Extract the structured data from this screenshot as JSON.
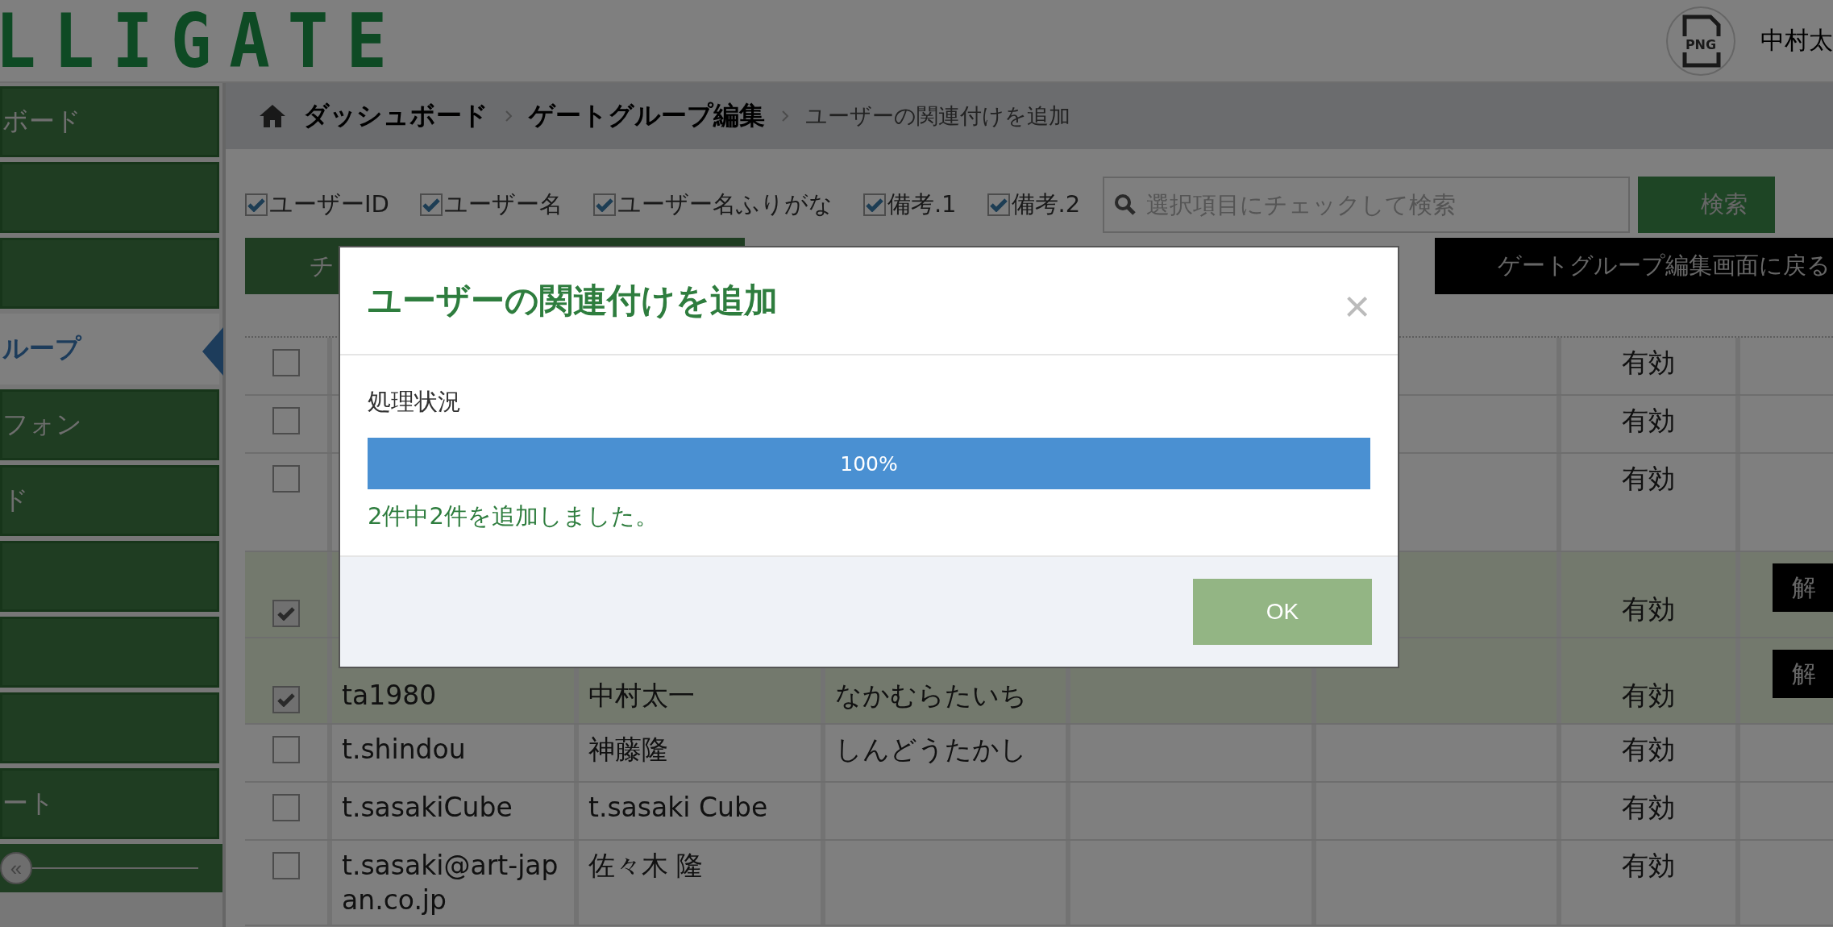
{
  "header": {
    "logo": "LLIGATE",
    "avatar_text": "PNG",
    "user_name": "中村太"
  },
  "sidebar": {
    "items": [
      {
        "label": "ボード",
        "selected": false
      },
      {
        "selected": false
      },
      {
        "selected": false
      },
      {
        "label": "ループ",
        "selected": true
      },
      {
        "label": "フォン",
        "selected": false
      },
      {
        "label": "ド",
        "selected": false
      },
      {
        "selected": false
      },
      {
        "selected": false
      },
      {
        "selected": false
      },
      {
        "label": "ート",
        "selected": false
      }
    ],
    "collapse": "«"
  },
  "breadcrumb": [
    {
      "label": "ダッシュボード",
      "kind": "link"
    },
    {
      "label": "ゲートグループ編集",
      "kind": "link"
    },
    {
      "label": "ユーザーの関連付けを追加",
      "kind": "current"
    }
  ],
  "filters": [
    {
      "label": "ユーザーID",
      "checked": true
    },
    {
      "label": "ユーザー名",
      "checked": true
    },
    {
      "label": "ユーザー名ふりがな",
      "checked": true
    },
    {
      "label": "備考.1",
      "checked": true
    },
    {
      "label": "備考.2",
      "checked": true
    }
  ],
  "search": {
    "placeholder": "選択項目にチェックして検索",
    "button": "検索"
  },
  "actions": {
    "primary": "チ",
    "back": "ゲートグループ編集画面に戻る"
  },
  "table": {
    "rows": [
      {
        "checked": false,
        "status": "有効"
      },
      {
        "checked": false,
        "status": "有効"
      },
      {
        "checked": false,
        "status": "有効"
      },
      {
        "checked": true,
        "status": "有効",
        "action": "解"
      },
      {
        "checked": true,
        "user_id": "ta1980",
        "name": "中村太一",
        "furigana": "なかむらたいち",
        "status": "有効",
        "action": "解"
      },
      {
        "checked": false,
        "user_id": "t.shindou",
        "name": "神藤隆",
        "furigana": "しんどうたかし",
        "status": "有効"
      },
      {
        "checked": false,
        "user_id": "t.sasakiCube",
        "name": "t.sasaki Cube",
        "status": "有効"
      },
      {
        "checked": false,
        "user_id": "t.sasaki@art-jap an.co.jp",
        "name": "佐々木 隆",
        "status": "有効"
      }
    ]
  },
  "dialog": {
    "title": "ユーザーの関連付けを追加",
    "close": "×",
    "status_label": "処理状況",
    "progress": {
      "level": 1,
      "reading": "100%"
    },
    "message": "2件中2件を追加しました。",
    "ok_button": "OK"
  }
}
